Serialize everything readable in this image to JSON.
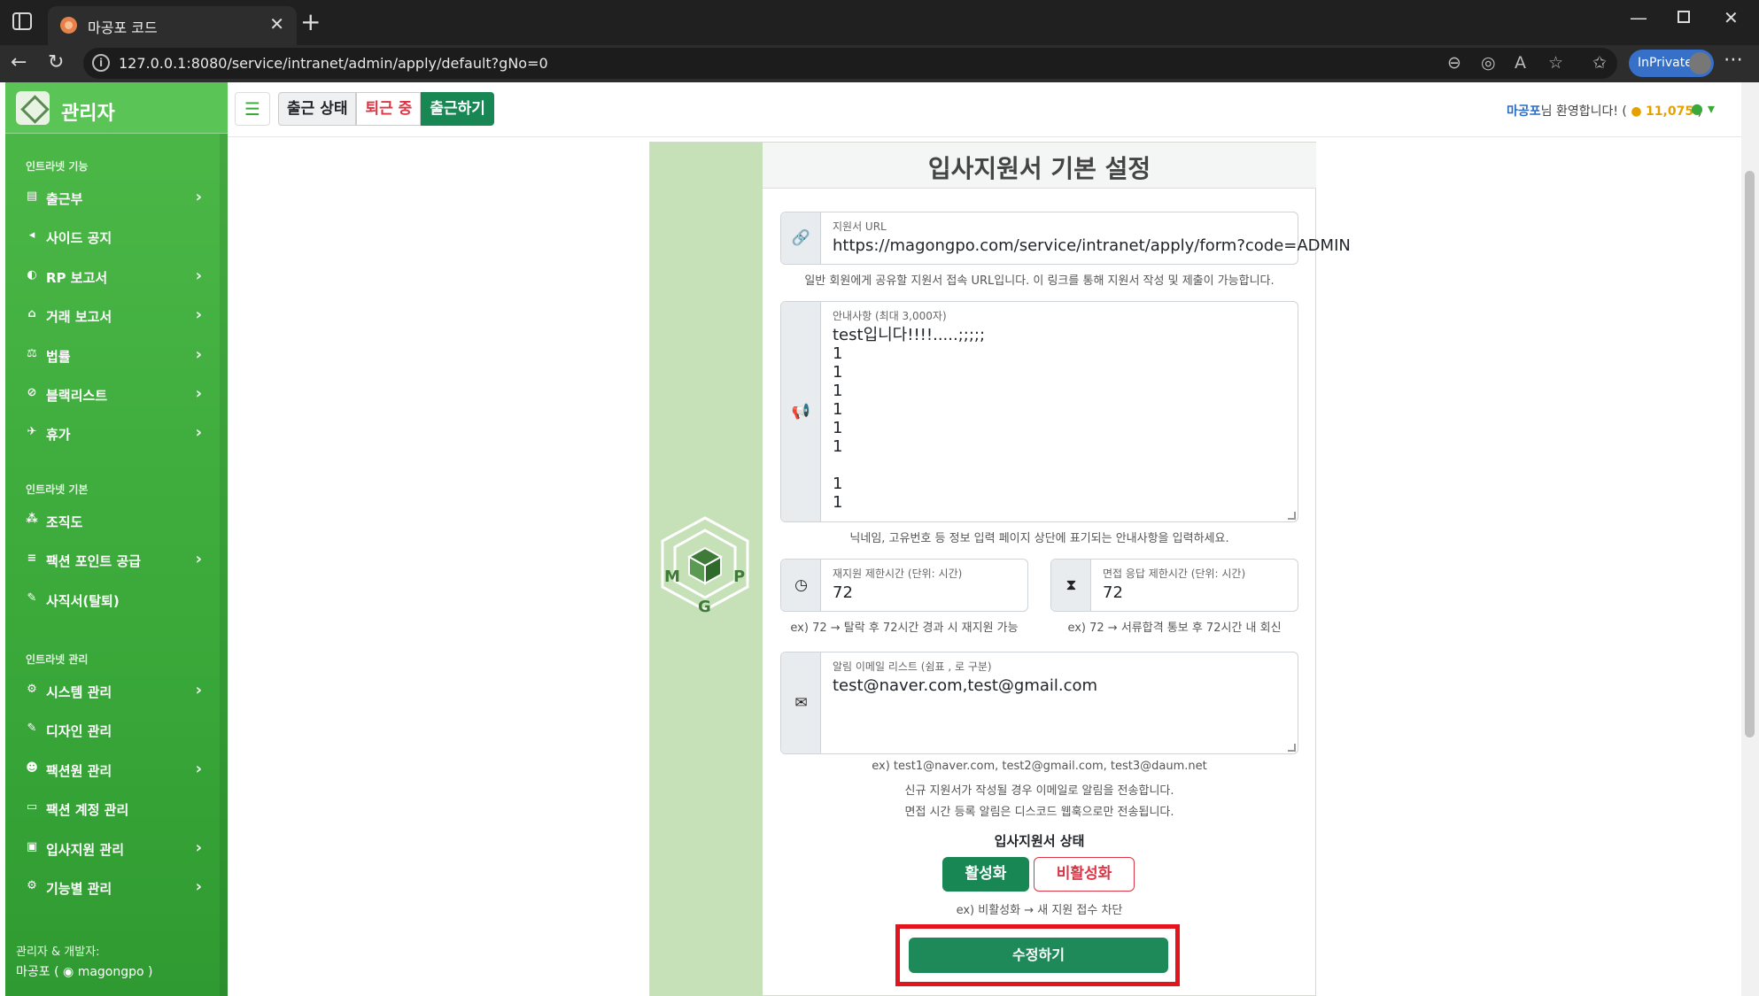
{
  "browser": {
    "tab_title": "마공포 코드",
    "url": "127.0.0.1:8080/service/intranet/admin/apply/default?gNo=0",
    "inprivate_label": "InPrivate"
  },
  "sidebar": {
    "brand": "관리자",
    "sections": [
      {
        "heading": "인트라넷 기능",
        "items": [
          {
            "label": "출근부",
            "icon": "book-icon",
            "chevron": true
          },
          {
            "label": "사이드 공지",
            "icon": "megaphone-icon",
            "chevron": false
          },
          {
            "label": "RP 보고서",
            "icon": "mask-icon",
            "chevron": true
          },
          {
            "label": "거래 보고서",
            "icon": "trade-icon",
            "chevron": true
          },
          {
            "label": "법률",
            "icon": "scale-icon",
            "chevron": true
          },
          {
            "label": "블랙리스트",
            "icon": "ban-icon",
            "chevron": true
          },
          {
            "label": "휴가",
            "icon": "plane-icon",
            "chevron": true
          }
        ]
      },
      {
        "heading": "인트라넷 기본",
        "items": [
          {
            "label": "조직도",
            "icon": "org-chart-icon",
            "chevron": false
          },
          {
            "label": "팩션 포인트 공급",
            "icon": "coins-icon",
            "chevron": true
          },
          {
            "label": "사직서(탈퇴)",
            "icon": "pen-icon",
            "chevron": false
          }
        ]
      },
      {
        "heading": "인트라넷 관리",
        "items": [
          {
            "label": "시스템 관리",
            "icon": "gear-icon",
            "chevron": true
          },
          {
            "label": "디자인 관리",
            "icon": "brush-icon",
            "chevron": false
          },
          {
            "label": "팩션원 관리",
            "icon": "user-gear-icon",
            "chevron": true
          },
          {
            "label": "팩션 계정 관리",
            "icon": "id-card-icon",
            "chevron": false
          },
          {
            "label": "입사지원 관리",
            "icon": "briefcase-icon",
            "chevron": true
          },
          {
            "label": "기능별 관리",
            "icon": "gears-icon",
            "chevron": true
          }
        ]
      }
    ],
    "footer": {
      "line1": "관리자 & 개발자:",
      "name": "마공포",
      "discord": "magongpo"
    }
  },
  "topbar": {
    "status_label": "출근 상태",
    "status_value": "퇴근 중",
    "checkin_button": "출근하기",
    "welcome_name": "마공포",
    "welcome_text": "님 환영합니다! (",
    "points": "11,075",
    "points_close": ")"
  },
  "form": {
    "title": "입사지원서 기본 설정",
    "url_field": {
      "label": "지원서 URL",
      "value": "https://magongpo.com/service/intranet/apply/form?code=ADMIN",
      "help": "일반 회원에게 공유할 지원서 접속 URL입니다. 이 링크를 통해 지원서 작성 및 제출이 가능합니다."
    },
    "notice_field": {
      "label": "안내사항 (최대 3,000자)",
      "value": "test입니다!!!!.....;;;;;\n1\n1\n1\n1\n1\n1\n\n1\n1",
      "help": "닉네임, 고유번호 등 정보 입력 페이지 상단에 표기되는 안내사항을 입력하세요."
    },
    "reapply_field": {
      "label": "재지원 제한시간 (단위: 시간)",
      "value": "72",
      "help": "ex) 72 → 탈락 후 72시간 경과 시 재지원 가능"
    },
    "interview_field": {
      "label": "면접 응답 제한시간 (단위: 시간)",
      "value": "72",
      "help": "ex) 72 → 서류합격 통보 후 72시간 내 회신"
    },
    "email_field": {
      "label": "알림 이메일 리스트 (쉼표 , 로 구분)",
      "value": "test@naver.com,test@gmail.com",
      "help1": "ex) test1@naver.com, test2@gmail.com, test3@daum.net",
      "help2": "신규 지원서가 작성될 경우 이메일로 알림을 전송합니다.",
      "help3": "면접 시간 등록 알림은 디스코드 웹훅으로만 전송됩니다."
    },
    "status": {
      "title": "입사지원서 상태",
      "active_label": "활성화",
      "inactive_label": "비활성화",
      "help": "ex) 비활성화 → 새 지원 접수 차단"
    },
    "submit_label": "수정하기"
  },
  "colors": {
    "sidebar_green": "#3aa93a",
    "card_side": "#c6e1b7",
    "primary_green": "#198754",
    "danger": "#dc3545",
    "highlight_red": "#e4141f"
  }
}
